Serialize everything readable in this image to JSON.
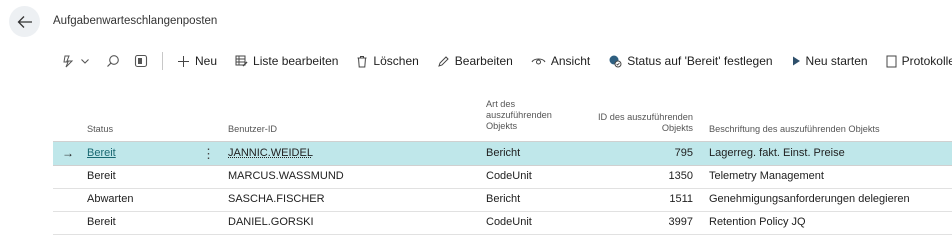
{
  "page": {
    "title": "Aufgabenwarteschlangenposten"
  },
  "toolbar": {
    "new": "Neu",
    "edit_list": "Liste bearbeiten",
    "delete": "Löschen",
    "edit": "Bearbeiten",
    "view": "Ansicht",
    "set_ready": "Status auf 'Bereit' festlegen",
    "restart": "Neu starten",
    "log_entries": "Protokolleinträge"
  },
  "table": {
    "columns": {
      "status": "Status",
      "user_id": "Benutzer-ID",
      "object_type_1": "Art des",
      "object_type_2": "auszuführenden",
      "object_type_3": "Objekts",
      "object_id_1": "ID des auszuführenden",
      "object_id_2": "Objekts",
      "caption": "Beschriftung des auszuführenden Objekts"
    },
    "rows": [
      {
        "status": "Bereit",
        "user": "JANNIC.WEIDEL",
        "type": "Bericht",
        "id": "795",
        "caption": "Lagerreg. fakt. Einst. Preise"
      },
      {
        "status": "Bereit",
        "user": "MARCUS.WASSMUND",
        "type": "CodeUnit",
        "id": "1350",
        "caption": "Telemetry Management"
      },
      {
        "status": "Abwarten",
        "user": "SASCHA.FISCHER",
        "type": "Bericht",
        "id": "1511",
        "caption": "Genehmigungsanforderungen delegieren"
      },
      {
        "status": "Bereit",
        "user": "DANIEL.GORSKI",
        "type": "CodeUnit",
        "id": "3997",
        "caption": "Retention Policy JQ"
      }
    ]
  },
  "colors": {
    "accent": "#1a6a73",
    "selected_row": "#bfe7ea",
    "back_button_bg": "#edf0f3"
  }
}
